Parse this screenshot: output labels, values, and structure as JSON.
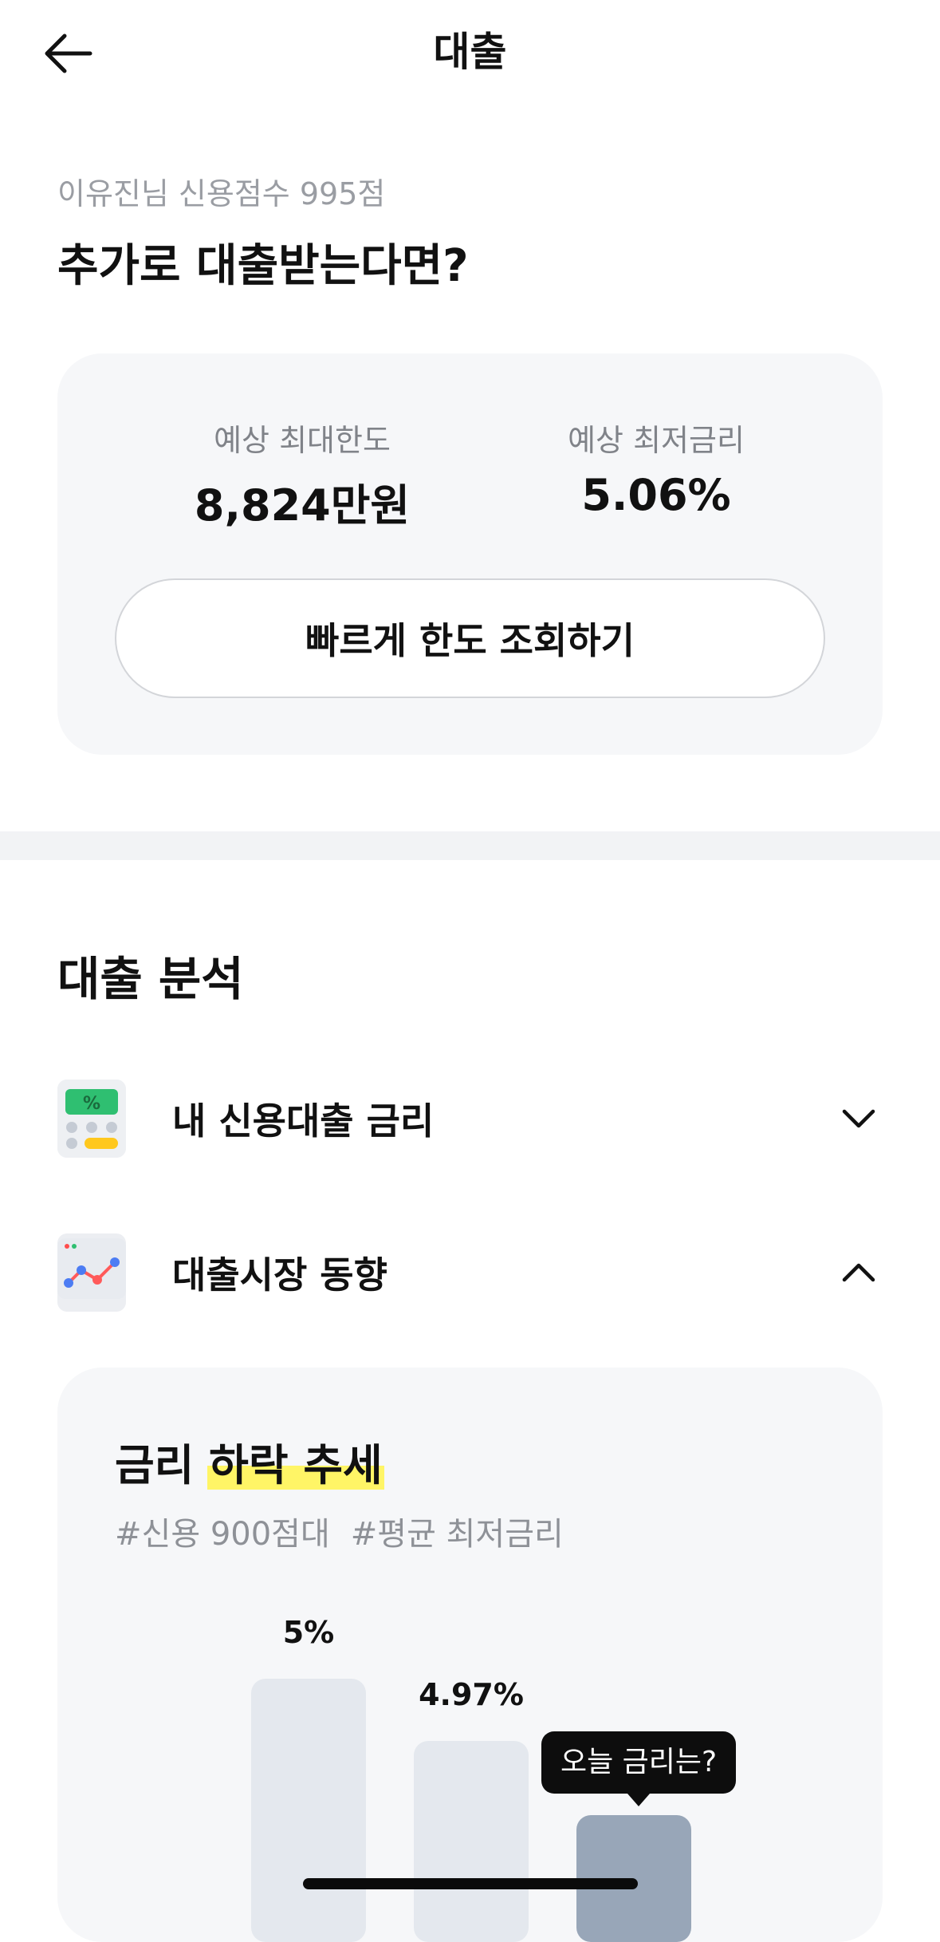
{
  "header": {
    "title": "대출",
    "back_icon": "arrow-left-icon"
  },
  "summary": {
    "subtitle": "이유진님 신용점수 995점",
    "headline": "추가로 대출받는다면?"
  },
  "estimate": {
    "limit_label": "예상 최대한도",
    "limit_value": "8,824만원",
    "rate_label": "예상 최저금리",
    "rate_value": "5.06%",
    "button_label": "빠르게 한도 조회하기"
  },
  "analysis": {
    "title": "대출 분석",
    "items": [
      {
        "label": "내 신용대출 금리",
        "icon": "calculator-icon",
        "expanded": false
      },
      {
        "label": "대출시장 동향",
        "icon": "line-chart-icon",
        "expanded": true
      }
    ]
  },
  "trend": {
    "title_prefix": "금리 ",
    "title_highlight": "하락 추세",
    "tags": [
      "#신용 900점대",
      "#평균 최저금리"
    ],
    "tooltip": "오늘 금리는?",
    "highlight_color": "#fff566",
    "bar_color": "#e4e8ee",
    "bar_today_color": "#98a6b8"
  },
  "chart_data": {
    "type": "bar",
    "categories": [
      "",
      "",
      ""
    ],
    "values": [
      5.0,
      4.97,
      null
    ],
    "data_labels": [
      "5%",
      "4.97%",
      ""
    ],
    "relative_bar_heights": [
      1.0,
      0.73,
      0.41
    ]
  }
}
